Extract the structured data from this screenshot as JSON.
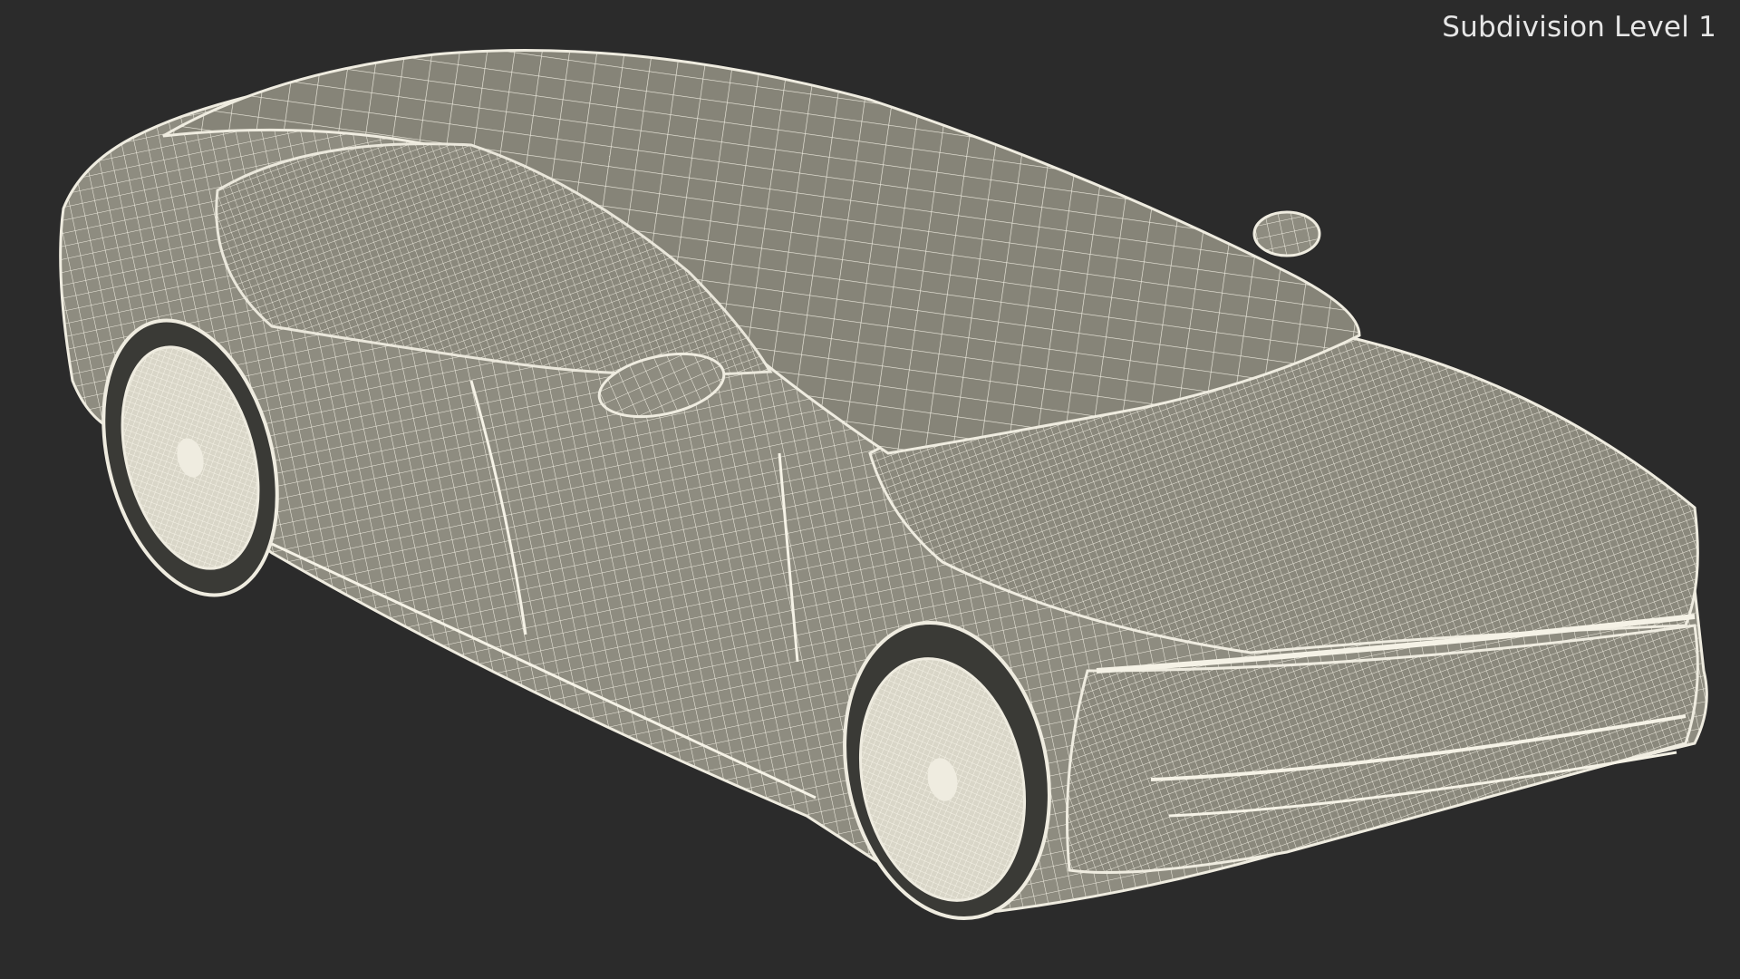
{
  "viewport": {
    "label": "Subdivision Level 1",
    "background_color": "#2b2b2b",
    "model_fill_color": "#8e8c80",
    "wire_color": "#efece0"
  },
  "model": {
    "subject": "sedan-car-wireframe",
    "render_mode": "wireframe-over-shaded"
  }
}
